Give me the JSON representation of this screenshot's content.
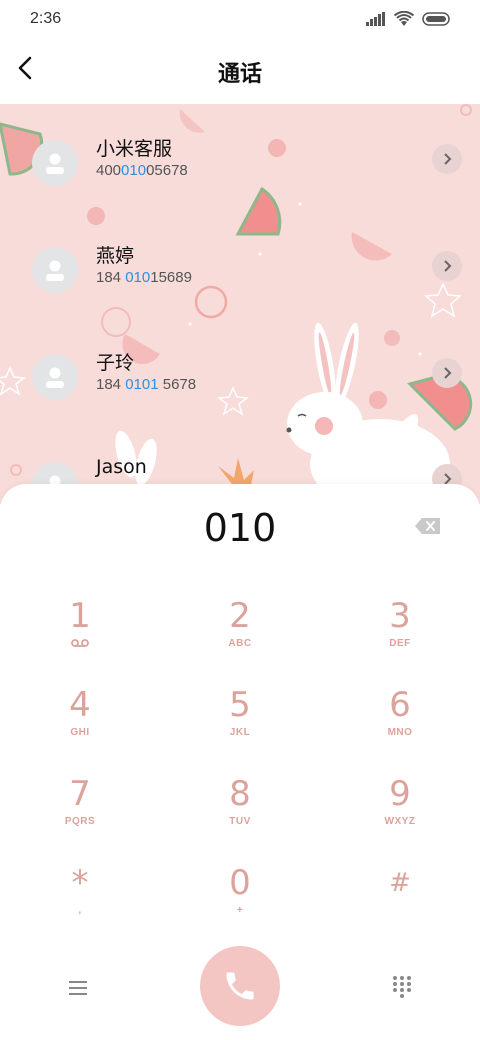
{
  "status": {
    "time": "2:36",
    "icons": [
      "signal-icon",
      "wifi-icon",
      "battery-icon"
    ]
  },
  "appbar": {
    "title": "通话",
    "back_icon": "back-arrow-icon"
  },
  "contacts": [
    {
      "name": "小米客服",
      "num_pre": "400",
      "num_hl": "010",
      "num_post": "05678"
    },
    {
      "name": "燕婷",
      "num_pre": "184 ",
      "num_hl": "010",
      "num_post": "15689"
    },
    {
      "name": "子玲",
      "num_pre": "184 ",
      "num_hl": "0101",
      "num_post": " 5678"
    },
    {
      "name": "Jason",
      "num_pre": "",
      "num_hl": "",
      "num_post": ""
    }
  ],
  "dialpad": {
    "number": "010",
    "keys": [
      {
        "digit": "1",
        "letters": ""
      },
      {
        "digit": "2",
        "letters": "ABC"
      },
      {
        "digit": "3",
        "letters": "DEF"
      },
      {
        "digit": "4",
        "letters": "GHI"
      },
      {
        "digit": "5",
        "letters": "JKL"
      },
      {
        "digit": "6",
        "letters": "MNO"
      },
      {
        "digit": "7",
        "letters": "PQRS"
      },
      {
        "digit": "8",
        "letters": "TUV"
      },
      {
        "digit": "9",
        "letters": "WXYZ"
      },
      {
        "digit": "*",
        "letters": ","
      },
      {
        "digit": "0",
        "letters": "+"
      },
      {
        "digit": "#",
        "letters": ""
      }
    ]
  },
  "colors": {
    "accent": "#dca39c",
    "highlight": "#2d8fe0",
    "call": "#f4c6c3",
    "wallpaper": "#f8dcda"
  }
}
